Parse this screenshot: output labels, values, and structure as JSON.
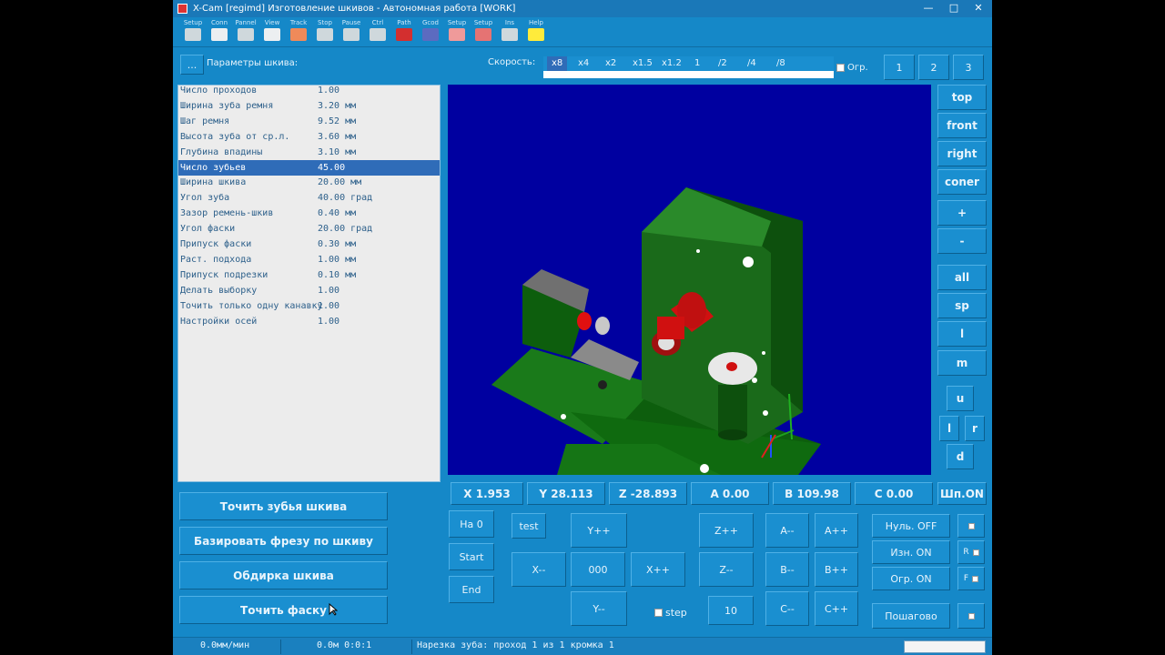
{
  "window": {
    "title": "X-Cam [regimd]  Изготовление шкивов - Автономная работа  [WORK]",
    "minimize": "—",
    "maximize": "□",
    "close": "✕"
  },
  "toolbar": [
    {
      "label": "Setup",
      "icon": "setup-icon",
      "color": "#cfd8dc"
    },
    {
      "label": "Conn",
      "icon": "connect-icon",
      "color": "#eceff1"
    },
    {
      "label": "Pannel",
      "icon": "panel-icon",
      "color": "#cfd8dc"
    },
    {
      "label": "View",
      "icon": "view-icon",
      "color": "#eceff1"
    },
    {
      "label": "Track",
      "icon": "track-icon",
      "color": "#ef8a5a"
    },
    {
      "label": "Stop",
      "icon": "stop-icon",
      "color": "#cfd8dc"
    },
    {
      "label": "Pause",
      "icon": "pause-icon",
      "color": "#cfd8dc"
    },
    {
      "label": "Ctrl",
      "icon": "control-icon",
      "color": "#cfd8dc"
    },
    {
      "label": "Path",
      "icon": "path-icon",
      "color": "#d32f2f"
    },
    {
      "label": "Gcod",
      "icon": "gcode-icon",
      "color": "#5c6bc0"
    },
    {
      "label": "Setup",
      "icon": "setup-tool-icon",
      "color": "#ef9a9a"
    },
    {
      "label": "Setup",
      "icon": "setup-wheel-icon",
      "color": "#e57373"
    },
    {
      "label": "Ins",
      "icon": "document-icon",
      "color": "#cfd8dc"
    },
    {
      "label": "Help",
      "icon": "help-icon",
      "color": "#ffeb3b"
    }
  ],
  "params_header": {
    "button": "...",
    "title": "Параметры шкива:"
  },
  "speed": {
    "label": "Скорость:",
    "options": [
      "x8",
      "x4",
      "x2",
      "x1.5",
      "x1.2",
      "1",
      "/2",
      "/4",
      "/8"
    ],
    "selected": "x8",
    "limit_label": "Огр."
  },
  "top_buttons": [
    "1",
    "2",
    "3"
  ],
  "params": [
    {
      "name": "Число проходов",
      "value": "1.00"
    },
    {
      "name": "Ширина зуба ремня",
      "value": "3.20 мм"
    },
    {
      "name": "Шаг ремня",
      "value": "9.52 мм"
    },
    {
      "name": "Высота зуба от ср.л.",
      "value": "3.60 мм"
    },
    {
      "name": "Глубина впадины",
      "value": "3.10 мм"
    },
    {
      "name": "Число зубьев",
      "value": "45.00",
      "selected": true
    },
    {
      "name": "Ширина шкива",
      "value": "20.00 мм"
    },
    {
      "name": "Угол зуба",
      "value": "40.00 град"
    },
    {
      "name": "Зазор ремень-шкив",
      "value": "0.40 мм"
    },
    {
      "name": "Угол фаски",
      "value": "20.00 град"
    },
    {
      "name": "Припуск фаски",
      "value": "0.30 мм"
    },
    {
      "name": "Раст. подхода",
      "value": "1.00 мм"
    },
    {
      "name": "Припуск подрезки",
      "value": "0.10 мм"
    },
    {
      "name": "Делать выборку",
      "value": "1.00"
    },
    {
      "name": "Точить только одну канавку",
      "value": "1.00"
    },
    {
      "name": "Настройки осей",
      "value": "1.00"
    }
  ],
  "view_buttons": [
    "top",
    "front",
    "right",
    "coner",
    "+",
    "-",
    "all",
    "sp",
    "l",
    "m",
    "u",
    "l",
    "r",
    "d"
  ],
  "coords": {
    "x": "X 1.953",
    "y": "Y 28.113",
    "z": "Z -28.893",
    "a": "A 0.00",
    "b": "B 109.98",
    "c": "C 0.00",
    "spindle": "Шп.ON"
  },
  "actions": [
    "Точить зубья шкива",
    "Базировать фрезу по шкиву",
    "Обдирка шкива",
    "Точить фаску"
  ],
  "jog": {
    "home": "На 0",
    "start": "Start",
    "end": "End",
    "test": "test",
    "y_plus": "Y++",
    "y_minus": "Y--",
    "x_minus": "X--",
    "zero": "000",
    "x_plus": "X++",
    "z_plus": "Z++",
    "z_minus": "Z--",
    "a_minus": "A--",
    "a_plus": "A++",
    "b_minus": "B--",
    "b_plus": "B++",
    "c_minus": "C--",
    "c_plus": "C++",
    "step_label": "step",
    "step_value": "10"
  },
  "toggles": {
    "null": "Нуль. OFF",
    "wear": "Изн. ON",
    "limit": "Огр. ON",
    "stepwise": "Пошагово",
    "r_label": "R",
    "f_label": "F"
  },
  "status": {
    "feed": "0.0мм/мин",
    "time": "0.0м 0:0:1",
    "message": "Нарезка зуба:  проход 1 из 1    кромка 1"
  }
}
